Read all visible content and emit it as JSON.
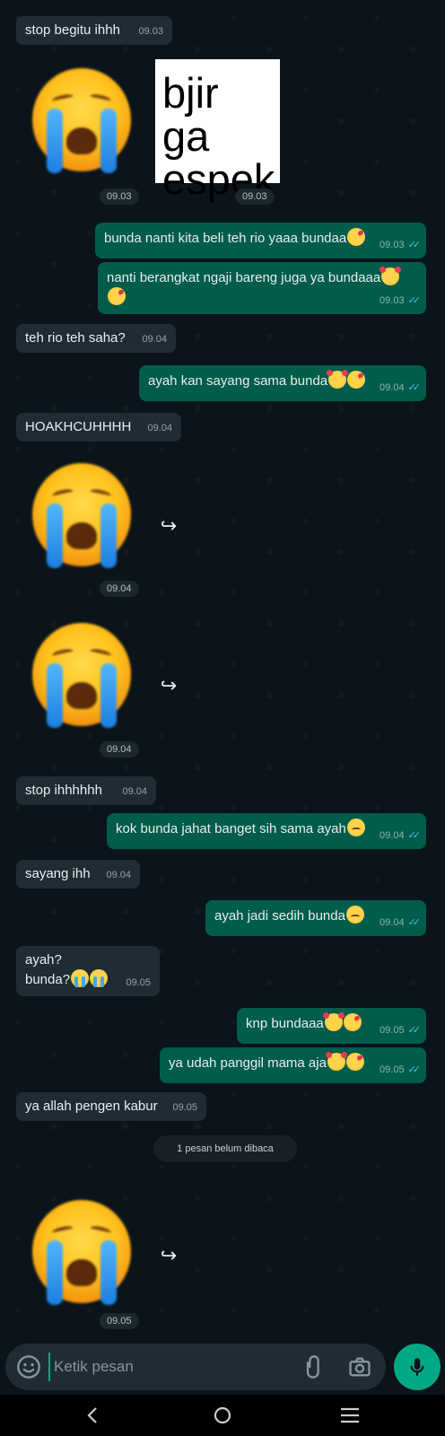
{
  "messages": [
    {
      "dir": "in",
      "text": "stop begitu ihhh",
      "time": "09.03"
    },
    {
      "dir": "in",
      "type": "sticker-cry",
      "time": "09.03"
    },
    {
      "dir": "in",
      "type": "sticker-text",
      "lines": [
        "bjir ga",
        "espek"
      ],
      "time": "09.03"
    },
    {
      "dir": "out",
      "text": "bunda nanti kita beli teh rio yaaa bundaa",
      "emoji": [
        "kiss"
      ],
      "time": "09.03"
    },
    {
      "dir": "out",
      "text": "nanti berangkat ngaji bareng juga ya bundaaa",
      "emoji": [
        "love",
        "kiss"
      ],
      "time": "09.03"
    },
    {
      "dir": "in",
      "text": "teh rio teh saha?",
      "time": "09.04"
    },
    {
      "dir": "out",
      "text": "ayah kan sayang sama bunda",
      "emoji": [
        "love",
        "kiss"
      ],
      "time": "09.04"
    },
    {
      "dir": "in",
      "text": "HOAKHCUHHHH",
      "time": "09.04"
    },
    {
      "dir": "in",
      "type": "sticker-cry",
      "time": "09.04"
    },
    {
      "dir": "in",
      "type": "sticker-cry",
      "time": "09.04"
    },
    {
      "dir": "in",
      "text": "stop ihhhhhh",
      "time": "09.04"
    },
    {
      "dir": "out",
      "text": "kok bunda jahat banget sih sama ayah",
      "emoji": [
        "sad"
      ],
      "time": "09.04"
    },
    {
      "dir": "in",
      "text": "sayang ihh",
      "time": "09.04"
    },
    {
      "dir": "out",
      "text": "ayah jadi sedih bunda",
      "emoji": [
        "sad"
      ],
      "time": "09.04"
    },
    {
      "dir": "in",
      "lines": [
        "ayah?",
        "bunda?"
      ],
      "emoji": [
        "cry",
        "cry"
      ],
      "time": "09.05"
    },
    {
      "dir": "out",
      "text": "knp bundaaa",
      "emoji": [
        "love",
        "kiss"
      ],
      "time": "09.05"
    },
    {
      "dir": "out",
      "text": "ya udah panggil mama aja",
      "emoji": [
        "love",
        "kiss"
      ],
      "time": "09.05"
    },
    {
      "dir": "in",
      "text": "ya allah pengen kabur",
      "time": "09.05"
    },
    {
      "dir": "in",
      "type": "sticker-cry",
      "time": "09.05"
    }
  ],
  "unread_banner": "1 pesan belum dibaca",
  "composer": {
    "placeholder": "Ketik pesan"
  },
  "icons": {
    "forward": "forward-arrow-icon",
    "emoji": "emoji-icon",
    "attach": "paperclip-icon",
    "camera": "camera-icon",
    "mic": "microphone-icon",
    "read": "double-check-icon"
  },
  "colors": {
    "incoming": "#202c33",
    "outgoing": "#005c4b",
    "accent": "#00a884",
    "read_tick": "#53bdeb"
  }
}
